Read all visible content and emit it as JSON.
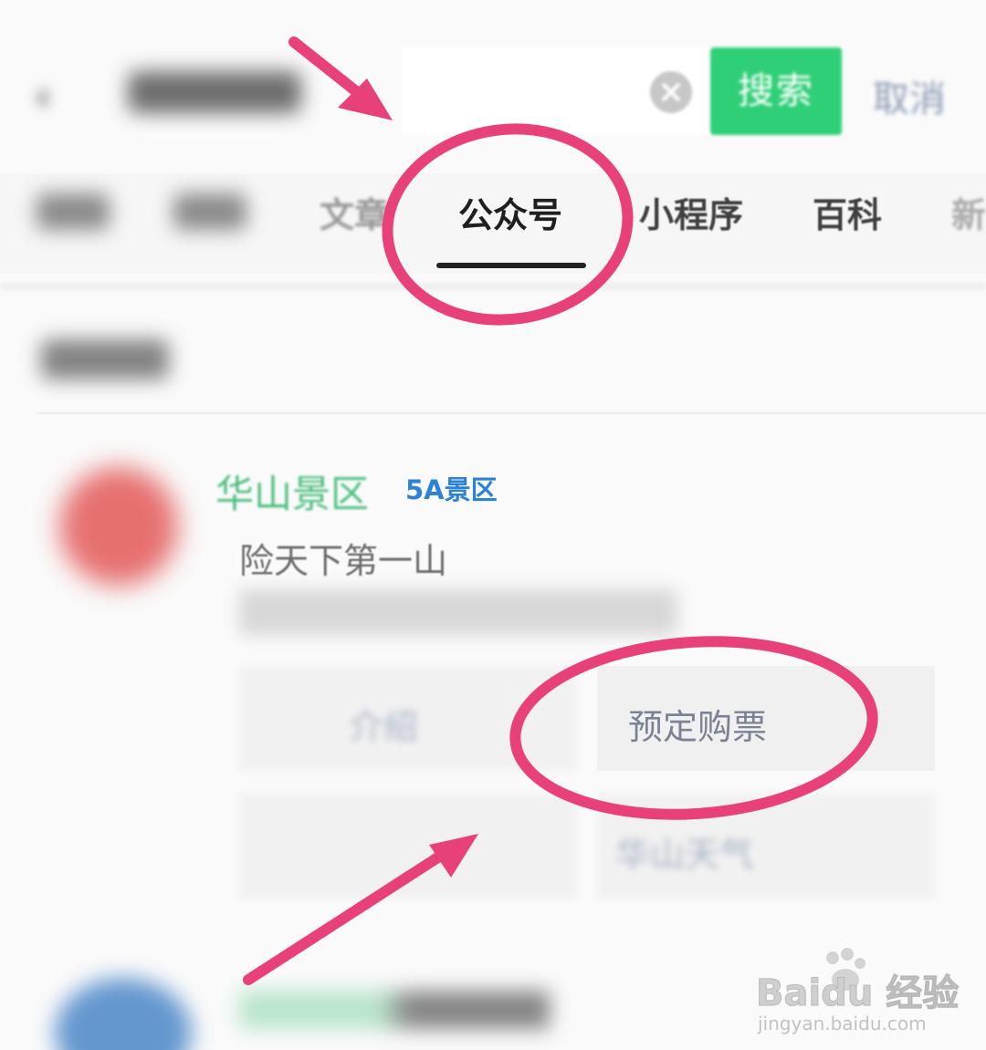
{
  "search": {
    "search_button": "搜索",
    "cancel": "取消"
  },
  "tabs": [
    {
      "label": "文章"
    },
    {
      "label": "公众号",
      "active": true
    },
    {
      "label": "小程序"
    },
    {
      "label": "百科"
    },
    {
      "label": "新"
    }
  ],
  "account": {
    "name": "华山景区",
    "badge": "5A景区",
    "slogan": "险天下第一山",
    "menu": [
      {
        "label": "介绍"
      },
      {
        "label": "预定购票"
      },
      {
        "label": ""
      },
      {
        "label": "华山天气"
      }
    ]
  },
  "watermark": {
    "logo": "Baidu 经验",
    "url": "jingyan.baidu.com"
  },
  "colors": {
    "accent_green": "#2fcf77",
    "badge_blue": "#2b82d8",
    "annotation_pink": "#e8417a"
  },
  "icons": [
    "back-chevron-icon",
    "clear-icon",
    "paw-logo-icon"
  ]
}
